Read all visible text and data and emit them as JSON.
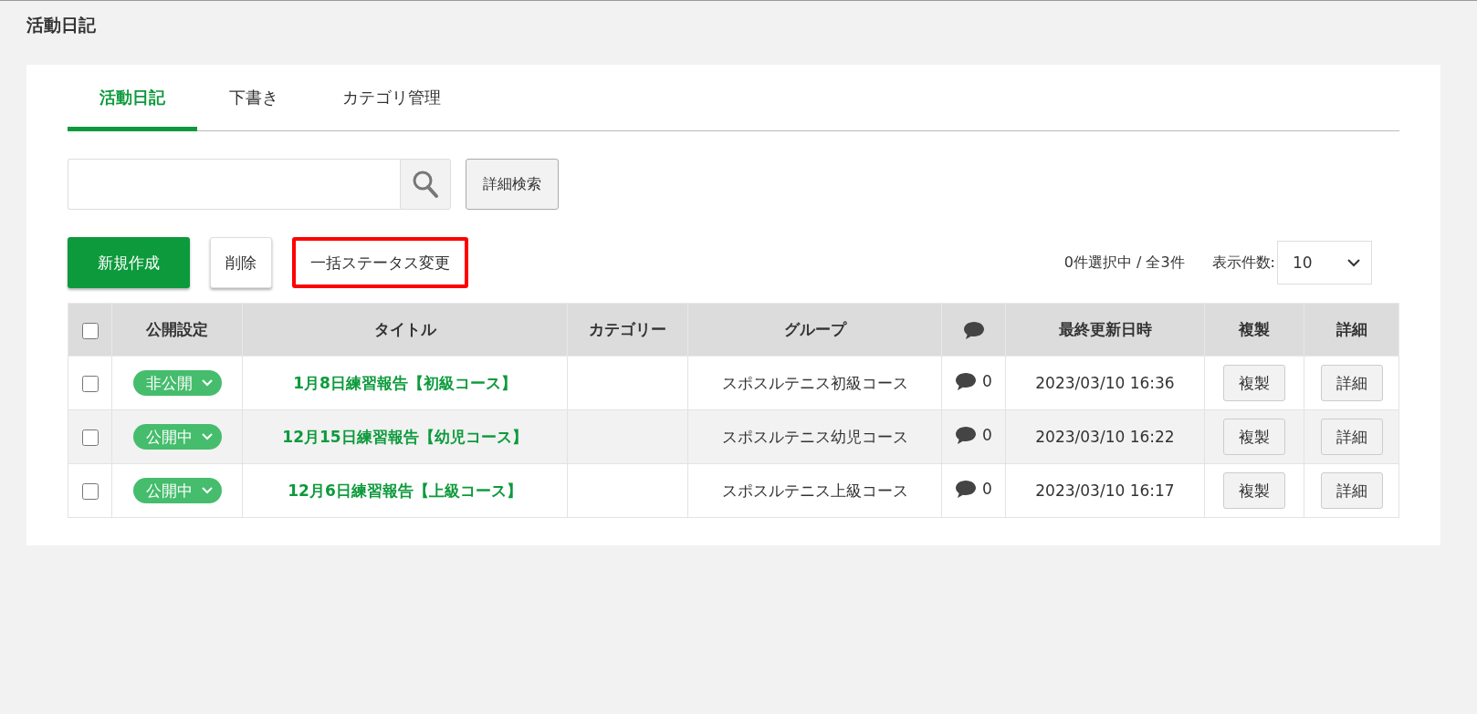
{
  "page_title": "活動日記",
  "tabs": [
    {
      "label": "活動日記",
      "selected": true
    },
    {
      "label": "下書き",
      "selected": false
    },
    {
      "label": "カテゴリ管理",
      "selected": false
    }
  ],
  "search": {
    "button": "詳細検索"
  },
  "actions": [
    {
      "label": "新規作成",
      "kind": "primary",
      "highlighted": false
    },
    {
      "label": "削除",
      "kind": "plain",
      "highlighted": false
    },
    {
      "label": "一括ステータス変更",
      "kind": "text",
      "highlighted": true
    }
  ],
  "selection_count": "0件選択中 / 全3件",
  "page_size": {
    "label": "表示件数:",
    "value": "10"
  },
  "table": {
    "select_all_checked": false,
    "columns": [
      "公開設定",
      "タイトル",
      "カテゴリー",
      "グループ",
      "",
      "最終更新日時",
      "複製",
      "詳細"
    ],
    "rows": [
      {
        "checked": false,
        "status": "非公開",
        "title": "1月8日練習報告【初級コース】",
        "group": "スポスルテニス初級コース",
        "comments": "0",
        "updated": "2023/03/10 16:36",
        "copy": "複製",
        "detail": "詳細"
      },
      {
        "checked": false,
        "status": "公開中",
        "title": "12月15日練習報告【幼児コース】",
        "group": "スポスルテニス幼児コース",
        "comments": "0",
        "updated": "2023/03/10 16:22",
        "copy": "複製",
        "detail": "詳細"
      },
      {
        "checked": false,
        "status": "公開中",
        "title": "12月6日練習報告【上級コース】",
        "group": "スポスルテニス上級コース",
        "comments": "0",
        "updated": "2023/03/10 16:17",
        "copy": "複製",
        "detail": "詳細"
      }
    ]
  }
}
